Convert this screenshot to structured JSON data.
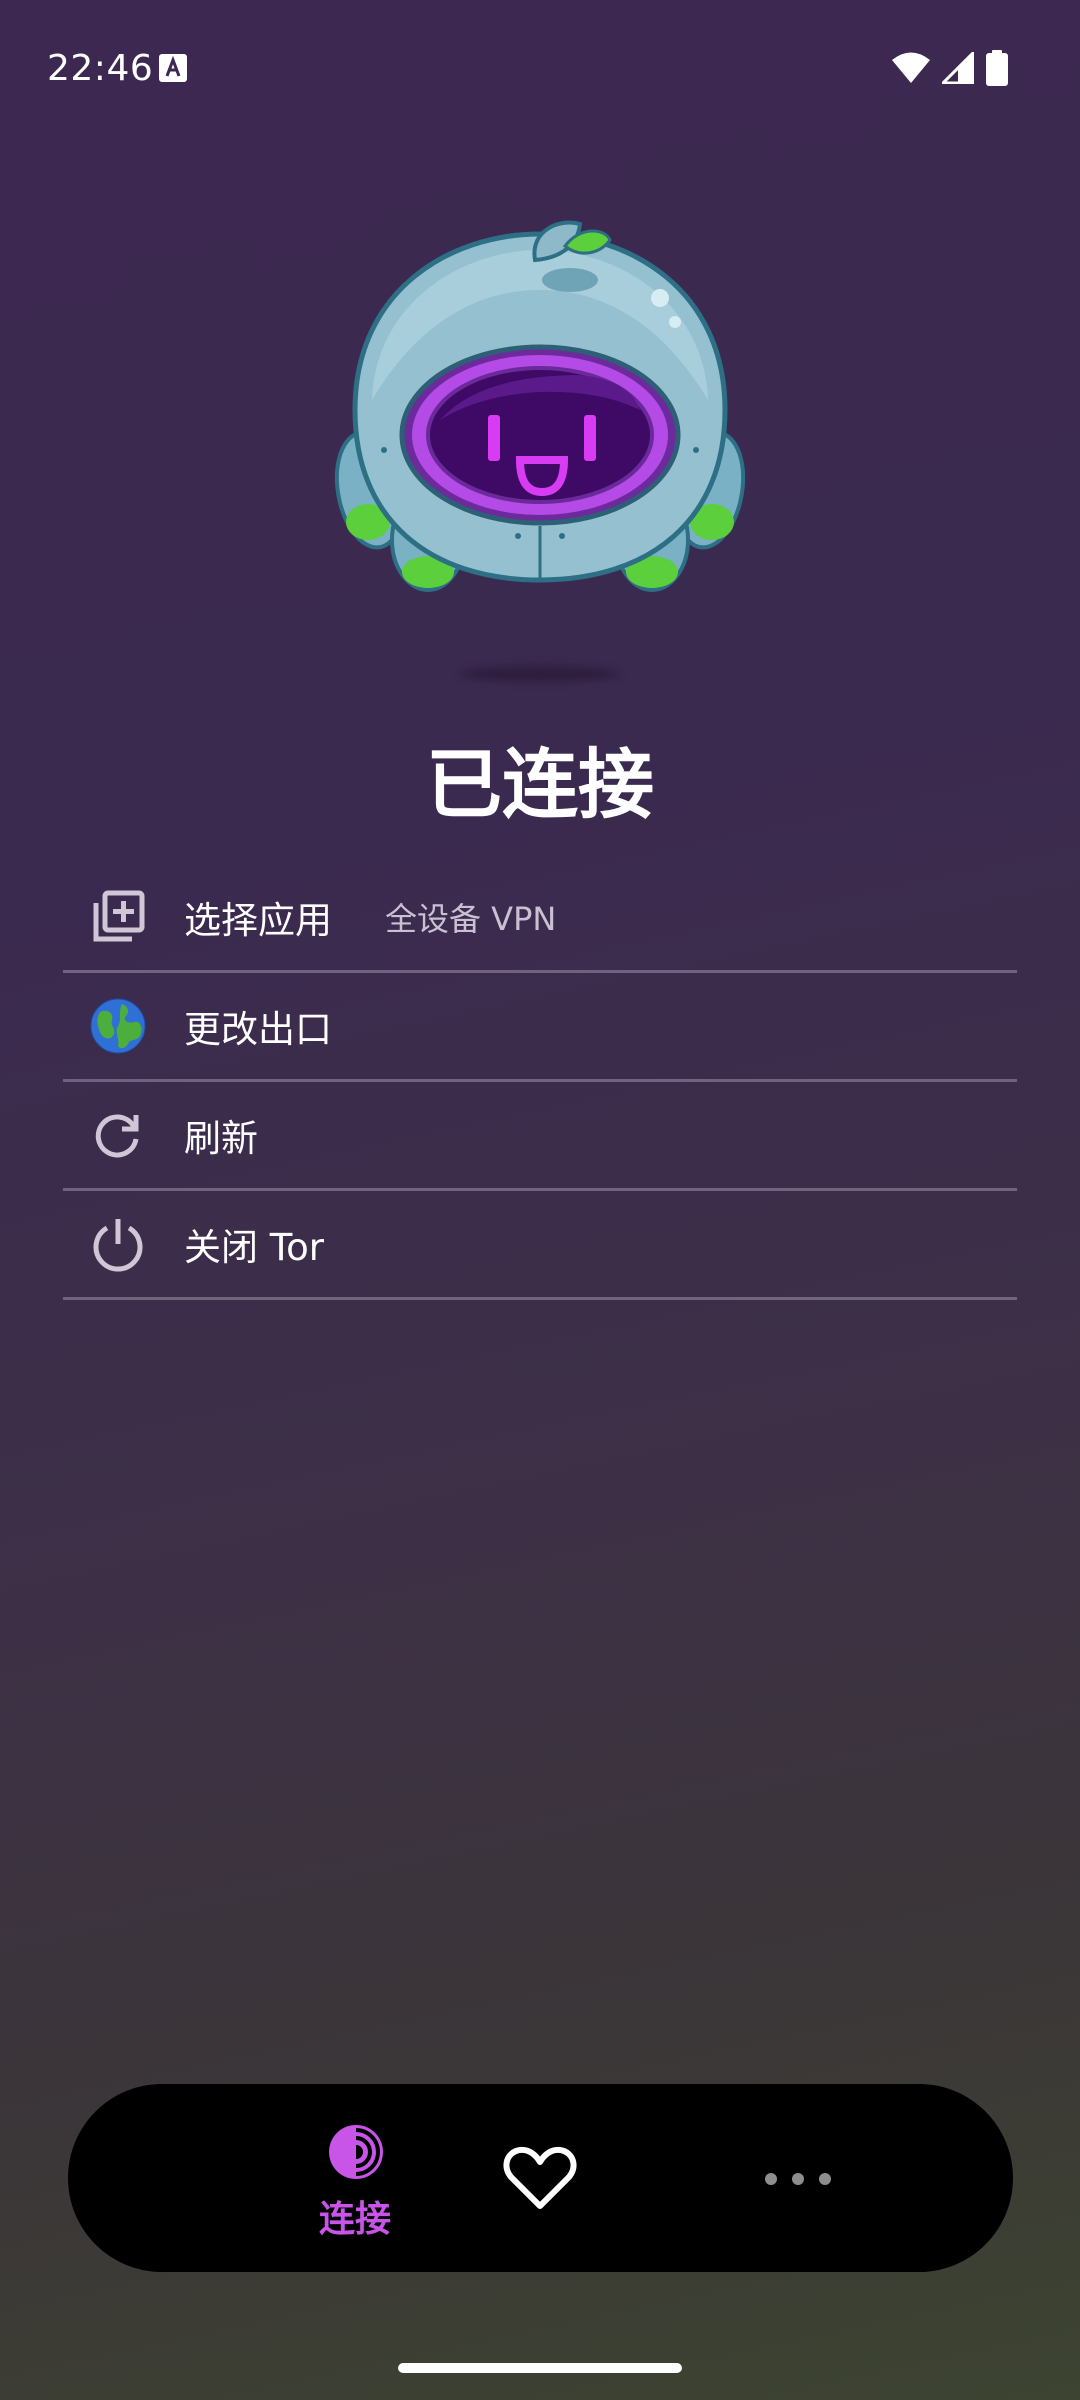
{
  "status_bar": {
    "time": "22:46",
    "icons": [
      "text-a-icon",
      "wifi-icon",
      "signal-icon",
      "battery-icon"
    ]
  },
  "hero": {
    "mascot": "onion-robot-mascot",
    "status": "已连接"
  },
  "menu": {
    "items": [
      {
        "label": "选择应用",
        "value": "全设备 VPN",
        "icon": "app-select-icon"
      },
      {
        "label": "更改出口",
        "icon": "globe-icon"
      },
      {
        "label": "刷新",
        "icon": "refresh-icon"
      },
      {
        "label": "关闭 Tor",
        "icon": "power-icon"
      }
    ]
  },
  "bottom_nav": {
    "connect_label": "连接",
    "items": [
      "tor-connect-icon",
      "heart-icon",
      "more-dots-icon"
    ],
    "active_color": "#c855e8"
  },
  "colors": {
    "background_top": "#3c2850",
    "background_bottom": "#3d4431",
    "divider": "#8f8599",
    "secondary_text": "#c9c1d1"
  }
}
